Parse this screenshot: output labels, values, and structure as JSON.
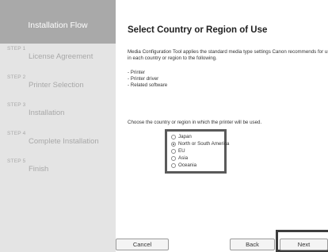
{
  "sidebar": {
    "title": "Installation Flow",
    "steps": [
      {
        "num": "STEP 1",
        "label": "License Agreement"
      },
      {
        "num": "STEP 2",
        "label": "Printer Selection"
      },
      {
        "num": "STEP 3",
        "label": "Installation"
      },
      {
        "num": "STEP 4",
        "label": "Complete Installation"
      },
      {
        "num": "STEP 5",
        "label": "Finish"
      }
    ]
  },
  "main": {
    "title": "Select Country or Region of Use",
    "description": "Media Configuration Tool applies the standard media type settings Canon recommends for use in each country or region to the following.",
    "bullets": [
      "- Printer",
      "- Printer driver",
      "- Related software"
    ],
    "prompt": "Choose the country or region in which the printer will be used.",
    "regions": [
      {
        "label": "Japan",
        "checked": false
      },
      {
        "label": "North or South America",
        "checked": true
      },
      {
        "label": "EU",
        "checked": false
      },
      {
        "label": "Asia",
        "checked": false
      },
      {
        "label": "Oceania",
        "checked": false
      }
    ]
  },
  "buttons": {
    "cancel": "Cancel",
    "back": "Back",
    "next": "Next"
  }
}
